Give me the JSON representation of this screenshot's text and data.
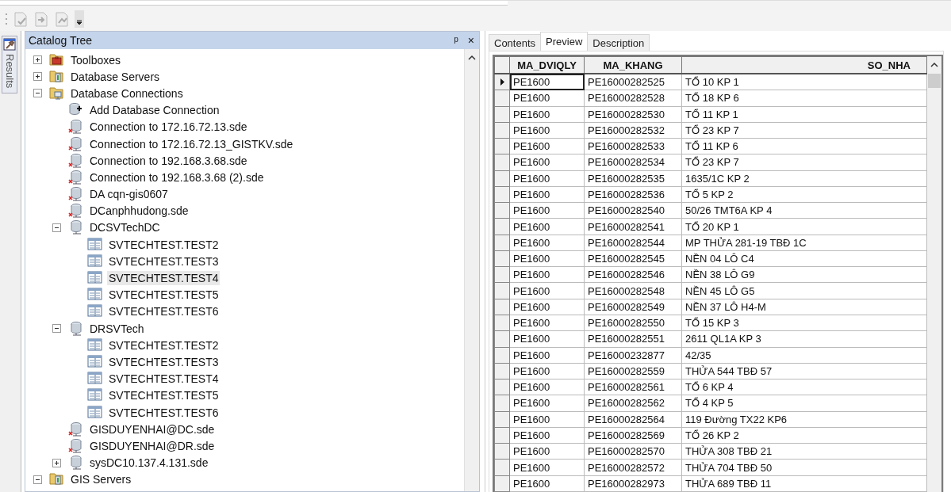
{
  "side_tab": {
    "label": "Results"
  },
  "catalog": {
    "title": "Catalog Tree",
    "pin": "ᵖ",
    "close": "×",
    "tree": [
      {
        "label": "Toolboxes",
        "kind": "toolbox",
        "expanded": false,
        "selected": false
      },
      {
        "label": "Database Servers",
        "kind": "servers",
        "expanded": false,
        "selected": false
      },
      {
        "label": "Database Connections",
        "kind": "connections",
        "expanded": true,
        "selected": false,
        "children": [
          {
            "label": "Add Database Connection",
            "kind": "add",
            "selected": false
          },
          {
            "label": "Connection to 172.16.72.13.sde",
            "kind": "broken",
            "selected": false
          },
          {
            "label": "Connection to 172.16.72.13_GISTKV.sde",
            "kind": "broken",
            "selected": false
          },
          {
            "label": "Connection to 192.168.3.68.sde",
            "kind": "broken",
            "selected": false
          },
          {
            "label": "Connection to 192.168.3.68 (2).sde",
            "kind": "broken",
            "selected": false
          },
          {
            "label": "DA cqn-gis0607",
            "kind": "broken",
            "selected": false
          },
          {
            "label": "DCanphhudong.sde",
            "kind": "broken",
            "selected": false
          },
          {
            "label": "DCSVTechDC",
            "kind": "db",
            "expanded": true,
            "selected": false,
            "children": [
              {
                "label": "SVTECHTEST.TEST2",
                "kind": "table",
                "selected": false
              },
              {
                "label": "SVTECHTEST.TEST3",
                "kind": "table",
                "selected": false
              },
              {
                "label": "SVTECHTEST.TEST4",
                "kind": "table",
                "selected": true
              },
              {
                "label": "SVTECHTEST.TEST5",
                "kind": "table",
                "selected": false
              },
              {
                "label": "SVTECHTEST.TEST6",
                "kind": "table",
                "selected": false
              }
            ]
          },
          {
            "label": "DRSVTech",
            "kind": "db",
            "expanded": true,
            "selected": false,
            "children": [
              {
                "label": "SVTECHTEST.TEST2",
                "kind": "table",
                "selected": false
              },
              {
                "label": "SVTECHTEST.TEST3",
                "kind": "table",
                "selected": false
              },
              {
                "label": "SVTECHTEST.TEST4",
                "kind": "table",
                "selected": false
              },
              {
                "label": "SVTECHTEST.TEST5",
                "kind": "table",
                "selected": false
              },
              {
                "label": "SVTECHTEST.TEST6",
                "kind": "table",
                "selected": false
              }
            ]
          },
          {
            "label": "GISDUYENHAI@DC.sde",
            "kind": "broken",
            "selected": false
          },
          {
            "label": "GISDUYENHAI@DR.sde",
            "kind": "broken",
            "selected": false
          },
          {
            "label": "sysDC10.137.4.131.sde",
            "kind": "db",
            "expanded": false,
            "selected": false
          }
        ]
      },
      {
        "label": "GIS Servers",
        "kind": "servers",
        "expanded": true,
        "selected": false
      }
    ]
  },
  "tabs": [
    {
      "label": "Contents",
      "selected": false
    },
    {
      "label": "Preview",
      "selected": true
    },
    {
      "label": "Description",
      "selected": false
    }
  ],
  "table": {
    "columns": [
      "MA_DVIQLY",
      "MA_KHANG",
      "SO_NHA"
    ],
    "rows": [
      {
        "current": true,
        "cells": [
          "PE1600",
          "PE16000282525",
          "TỔ 10 KP 1"
        ]
      },
      {
        "current": false,
        "cells": [
          "PE1600",
          "PE16000282528",
          "TỔ 18 KP 6"
        ]
      },
      {
        "current": false,
        "cells": [
          "PE1600",
          "PE16000282530",
          "TỔ 11 KP 1"
        ]
      },
      {
        "current": false,
        "cells": [
          "PE1600",
          "PE16000282532",
          "TỔ 23 KP 7"
        ]
      },
      {
        "current": false,
        "cells": [
          "PE1600",
          "PE16000282533",
          "TỔ 11 KP 6"
        ]
      },
      {
        "current": false,
        "cells": [
          "PE1600",
          "PE16000282534",
          "TỔ 23 KP 7"
        ]
      },
      {
        "current": false,
        "cells": [
          "PE1600",
          "PE16000282535",
          "1635/1C KP 2"
        ]
      },
      {
        "current": false,
        "cells": [
          "PE1600",
          "PE16000282536",
          "TỔ 5 KP 2"
        ]
      },
      {
        "current": false,
        "cells": [
          "PE1600",
          "PE16000282540",
          "50/26 TMT6A KP 4"
        ]
      },
      {
        "current": false,
        "cells": [
          "PE1600",
          "PE16000282541",
          "TỔ 20 KP 1"
        ]
      },
      {
        "current": false,
        "cells": [
          "PE1600",
          "PE16000282544",
          "MP THỬA 281-19 TBĐ 1C"
        ]
      },
      {
        "current": false,
        "cells": [
          "PE1600",
          "PE16000282545",
          "NỀN 04 LÔ C4"
        ]
      },
      {
        "current": false,
        "cells": [
          "PE1600",
          "PE16000282546",
          "NỀN 38 LÔ G9"
        ]
      },
      {
        "current": false,
        "cells": [
          "PE1600",
          "PE16000282548",
          "NỀN 45 LÔ G5"
        ]
      },
      {
        "current": false,
        "cells": [
          "PE1600",
          "PE16000282549",
          "NỀN 37 LÔ H4-M"
        ]
      },
      {
        "current": false,
        "cells": [
          "PE1600",
          "PE16000282550",
          "TỔ 15 KP 3"
        ]
      },
      {
        "current": false,
        "cells": [
          "PE1600",
          "PE16000282551",
          "2611 QL1A KP 3"
        ]
      },
      {
        "current": false,
        "cells": [
          "PE1600",
          "PE16000232877",
          "42/35"
        ]
      },
      {
        "current": false,
        "cells": [
          "PE1600",
          "PE16000282559",
          "THỬA 544 TBĐ 57"
        ]
      },
      {
        "current": false,
        "cells": [
          "PE1600",
          "PE16000282561",
          "TỔ 6 KP 4"
        ]
      },
      {
        "current": false,
        "cells": [
          "PE1600",
          "PE16000282562",
          "TỔ 4 KP 5"
        ]
      },
      {
        "current": false,
        "cells": [
          "PE1600",
          "PE16000282564",
          "119 Đường TX22 KP6"
        ]
      },
      {
        "current": false,
        "cells": [
          "PE1600",
          "PE16000282569",
          "TỔ 26 KP 2"
        ]
      },
      {
        "current": false,
        "cells": [
          "PE1600",
          "PE16000282570",
          "THỬA 308 TBĐ 21"
        ]
      },
      {
        "current": false,
        "cells": [
          "PE1600",
          "PE16000282572",
          "THỬA 704 TBĐ 50"
        ]
      },
      {
        "current": false,
        "cells": [
          "PE1600",
          "PE16000282973",
          "THỬA 689 TBĐ 11"
        ]
      }
    ]
  }
}
